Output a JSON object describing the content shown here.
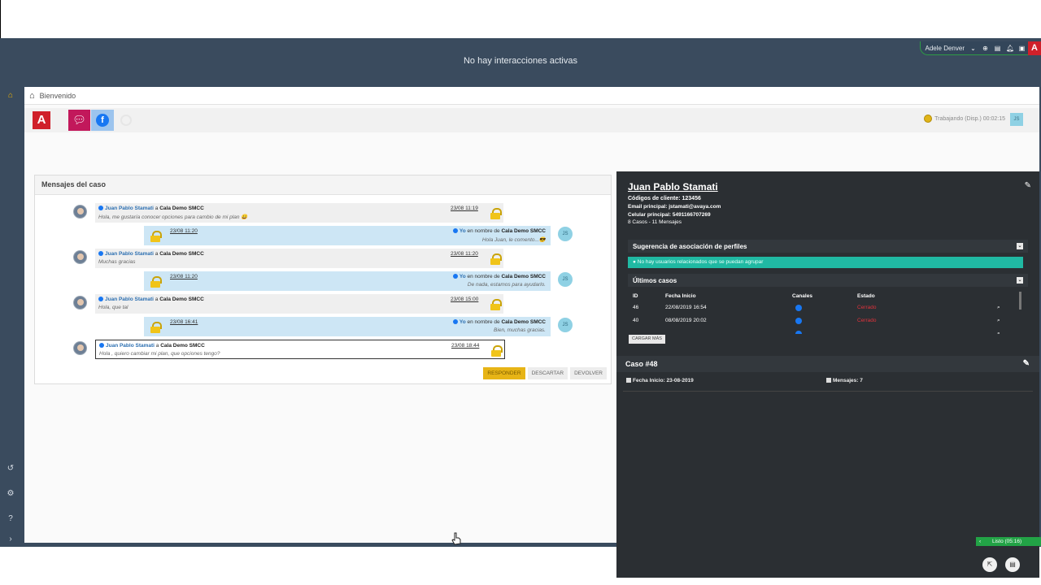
{
  "topbar": {
    "title": "No hay interacciones activas",
    "user_name": "Adele Denver",
    "icons": [
      "chevron-down-icon",
      "plus-circle-icon",
      "clipboard-icon",
      "bell-icon",
      "id-card-icon"
    ],
    "logo_letter": "A"
  },
  "left_rail": {
    "icons": [
      "home-icon",
      "history-icon",
      "gear-icon",
      "help-icon",
      "chevron-right-icon"
    ]
  },
  "breadcrumb": {
    "label": "Bienvenido"
  },
  "toolbar": {
    "logo_letter": "A",
    "status_text": "Trabajando (Disp.) 00:02:15",
    "avatar_initials": "JS"
  },
  "messages": {
    "header": "Mensajes del caso",
    "items": [
      {
        "dir": "in",
        "sender": "Juan Pablo Stamati",
        "connector": "a",
        "recipient": "Cala Demo SMCC",
        "timestamp": "23/08 11:19",
        "text": "Hola, me gustaría conocer opciones para cambio de mi plan 😀"
      },
      {
        "dir": "out",
        "sender": "Yo",
        "connector": "en nombre de",
        "recipient": "Cala Demo SMCC",
        "timestamp": "23/08 11:20",
        "text": "Hola Juan, le comento...😎"
      },
      {
        "dir": "in",
        "sender": "Juan Pablo Stamati",
        "connector": "a",
        "recipient": "Cala Demo SMCC",
        "timestamp": "23/08 11:20",
        "text": "Muchas gracias"
      },
      {
        "dir": "out",
        "sender": "Yo",
        "connector": "en nombre de",
        "recipient": "Cala Demo SMCC",
        "timestamp": "23/08 11:20",
        "text": "De nada, estamos para ayudarlo."
      },
      {
        "dir": "in",
        "sender": "Juan Pablo Stamati",
        "connector": "a",
        "recipient": "Cala Demo SMCC",
        "timestamp": "23/08 15:00",
        "text": "Hola, que tal"
      },
      {
        "dir": "out",
        "sender": "Yo",
        "connector": "en nombre de",
        "recipient": "Cala Demo SMCC",
        "timestamp": "23/08 16:41",
        "text": "Bien, muchas gracias."
      },
      {
        "dir": "sel",
        "sender": "Juan Pablo Stamati",
        "connector": "a",
        "recipient": "Cala Demo SMCC",
        "timestamp": "23/08 18:44",
        "text": "Hola , quiero cambiar mi plan, que opciones tengo?"
      }
    ],
    "out_avatar": "JS",
    "buttons": {
      "respond": "Responder",
      "discard": "Descartar",
      "return": "Devolver"
    }
  },
  "profile": {
    "name": "Juan Pablo Stamati",
    "client_codes": "Códigos de cliente: 123456",
    "email_label": "Email principal:",
    "email": "jstamati@avaya.com",
    "phone_label": "Celular principal:",
    "phone": "5491166707269",
    "counts": "8 Casos - 11 Mensajes",
    "suggestion_header": "Sugerencia de asociación de perfiles",
    "suggestion_banner": "No hay usuarios relacionados que se puedan agrupar",
    "cases_header": "Últimos casos",
    "table": {
      "columns": [
        "ID",
        "Fecha Inicio",
        "Canales",
        "Estado"
      ],
      "rows": [
        {
          "id": "46",
          "date": "22/08/2019 16:54",
          "status": "Cerrado"
        },
        {
          "id": "40",
          "date": "08/08/2019 20:02",
          "status": "Cerrado"
        },
        {
          "id": "",
          "date": "",
          "status": ""
        }
      ]
    },
    "load_more": "Cargar más"
  },
  "case": {
    "title": "Caso #48",
    "start_label": "Fecha Inicio: 23-08-2019",
    "messages_label": "Mensajes: 7"
  },
  "statusbar": {
    "text": "Listo (05:16)"
  },
  "colors": {
    "frame": "#3a4b5e",
    "dark_panel": "#2b2f33",
    "accent_red": "#d0202a",
    "facebook": "#1877f2",
    "teal_banner": "#20b9a3",
    "respond_button": "#e7b416",
    "status_green": "#22a346"
  }
}
